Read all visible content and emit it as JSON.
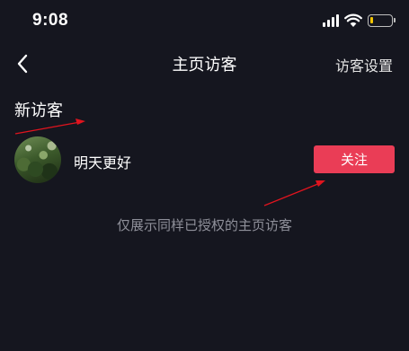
{
  "status_bar": {
    "time": "9:08",
    "battery_level": 0.15
  },
  "nav": {
    "back_icon": "chevron-left-icon",
    "title": "主页访客",
    "settings_label": "访客设置"
  },
  "section": {
    "title": "新访客"
  },
  "visitors": [
    {
      "name": "明天更好",
      "follow_label": "关注"
    }
  ],
  "footnote": "仅展示同样已授权的主页访客",
  "colors": {
    "background": "#15161f",
    "follow_button": "#ea3d56",
    "annotation_arrow": "#e0141e",
    "battery": "#f2c400"
  }
}
